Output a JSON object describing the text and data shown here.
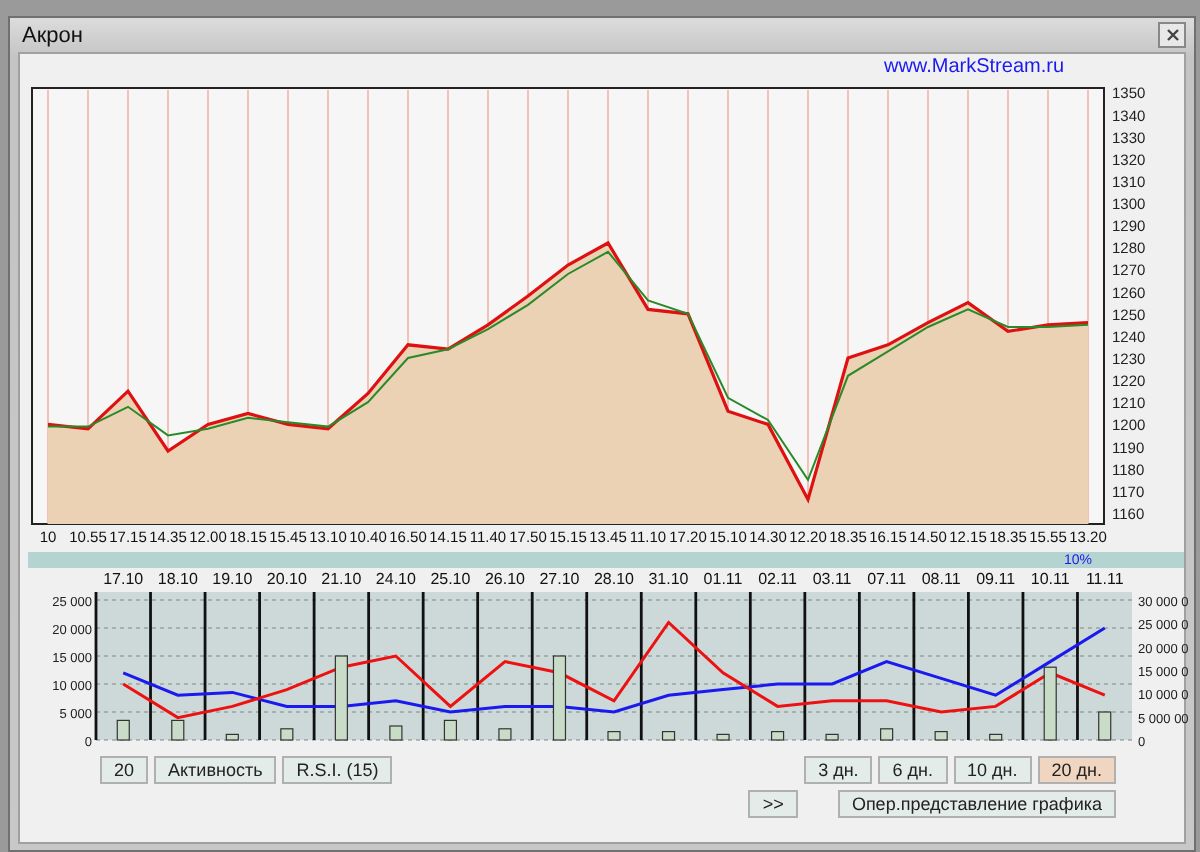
{
  "window": {
    "title": "Акрон"
  },
  "link": "www.MarkStream.ru",
  "price_chart": {
    "chart_data": {
      "type": "area",
      "grid": true,
      "categories": [
        "10",
        "10.55",
        "17.15",
        "14.35",
        "12.00",
        "18.15",
        "15.45",
        "13.10",
        "10.40",
        "16.50",
        "14.15",
        "11.40",
        "17.50",
        "15.15",
        "13.45",
        "11.10",
        "17.20",
        "15.10",
        "14.30",
        "12.20",
        "18.35",
        "16.15",
        "14.50",
        "12.15",
        "18.35",
        "15.55",
        "13.20"
      ],
      "yticks": [
        1160,
        1170,
        1180,
        1190,
        1200,
        1210,
        1220,
        1230,
        1240,
        1250,
        1260,
        1270,
        1280,
        1290,
        1300,
        1310,
        1320,
        1330,
        1340,
        1350
      ],
      "ylim": [
        1155,
        1352
      ],
      "series": [
        {
          "type": "area",
          "color": "#dd1111",
          "values": [
            1200,
            1198,
            1215,
            1188,
            1200,
            1205,
            1200,
            1198,
            1214,
            1236,
            1234,
            1245,
            1258,
            1272,
            1282,
            1252,
            1250,
            1206,
            1200,
            1166,
            1230,
            1236,
            1246,
            1255,
            1242,
            1245,
            1246
          ]
        },
        {
          "type": "line",
          "color": "#2a8a2a",
          "values": [
            1199,
            1199,
            1208,
            1195,
            1198,
            1203,
            1201,
            1199,
            1210,
            1230,
            1234,
            1243,
            1254,
            1268,
            1278,
            1256,
            1250,
            1212,
            1202,
            1175,
            1222,
            1233,
            1244,
            1252,
            1244,
            1244,
            1245
          ]
        }
      ]
    }
  },
  "indicator_strip": {
    "label": "10%"
  },
  "activity_chart": {
    "right_axis_labels": [
      "30 000 0",
      "25 000 0",
      "20 000 0",
      "15 000 0",
      "10 000 0",
      "5 000 00",
      "0"
    ],
    "chart_data": {
      "type": "line",
      "grid": true,
      "categories": [
        "17.10",
        "18.10",
        "19.10",
        "20.10",
        "21.10",
        "24.10",
        "25.10",
        "26.10",
        "27.10",
        "28.10",
        "31.10",
        "01.11",
        "02.11",
        "03.11",
        "07.11",
        "08.11",
        "09.11",
        "10.11",
        "11.11"
      ],
      "yticks": [
        {
          "value": 0,
          "label": "0"
        },
        {
          "value": 5000,
          "label": "5 000"
        },
        {
          "value": 10000,
          "label": "10 000"
        },
        {
          "value": 15000,
          "label": "15 000"
        },
        {
          "value": 20000,
          "label": "20 000"
        },
        {
          "value": 25000,
          "label": "25 000"
        }
      ],
      "ylim": [
        0,
        25000
      ],
      "series": [
        {
          "color": "#1a1aee",
          "values": [
            12000,
            8000,
            8500,
            6000,
            6000,
            7000,
            5000,
            6000,
            6000,
            5000,
            8000,
            9000,
            10000,
            10000,
            14000,
            11000,
            8000,
            14000,
            20000
          ]
        },
        {
          "color": "#ee1111",
          "values": [
            10000,
            4000,
            6000,
            9000,
            13000,
            15000,
            6000,
            14000,
            12000,
            7000,
            21000,
            12000,
            6000,
            7000,
            7000,
            5000,
            6000,
            12000,
            8000
          ]
        },
        {
          "type": "bar",
          "color": "#c8dcc8",
          "values": [
            3500,
            3500,
            1000,
            2000,
            15000,
            2500,
            3500,
            2000,
            15000,
            1500,
            1500,
            1000,
            1500,
            1000,
            2000,
            1500,
            1000,
            13000,
            5000
          ]
        }
      ]
    }
  },
  "left_buttons": [
    {
      "label": "20"
    },
    {
      "label": "Активность"
    },
    {
      "label": "R.S.I. (15)"
    }
  ],
  "period_tabs": [
    {
      "label": "3 дн.",
      "selected": false
    },
    {
      "label": "6 дн.",
      "selected": false
    },
    {
      "label": "10 дн.",
      "selected": false
    },
    {
      "label": "20 дн.",
      "selected": true
    }
  ],
  "scroll_button": {
    "label": ">>"
  },
  "mode_button": {
    "label": "Опер.представление графика"
  }
}
